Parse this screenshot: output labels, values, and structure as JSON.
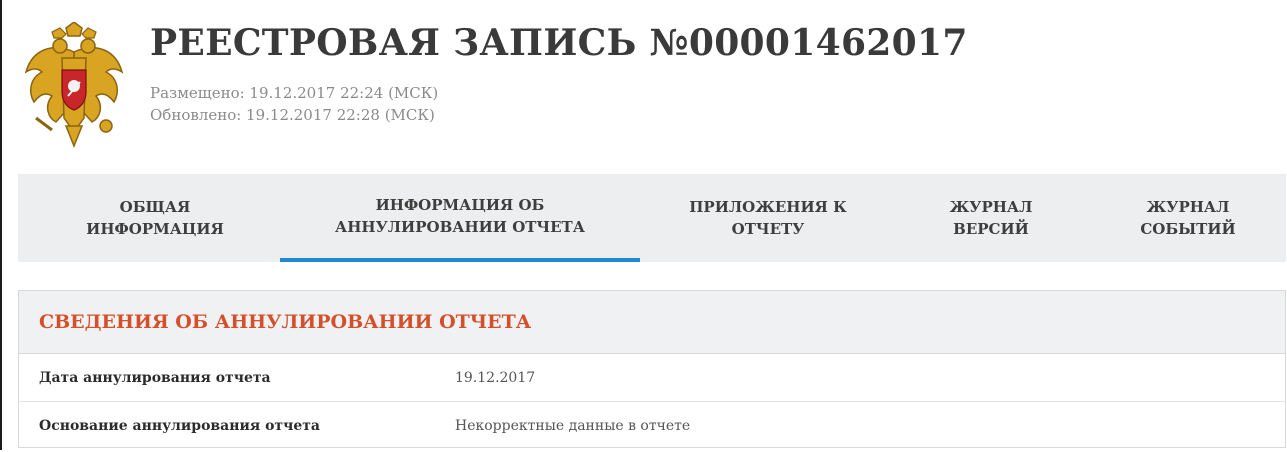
{
  "header": {
    "emblem": "russian-coat-of-arms",
    "title": "РЕЕСТРОВАЯ ЗАПИСЬ №00001462017",
    "posted": "Размещено: 19.12.2017 22:24 (МСК)",
    "updated": "Обновлено: 19.12.2017 22:28 (МСК)"
  },
  "tabs": [
    {
      "line1": "ОБЩАЯ",
      "line2": "ИНФОРМАЦИЯ",
      "active": false
    },
    {
      "line1": "ИНФОРМАЦИЯ ОБ",
      "line2": "АННУЛИРОВАНИИ ОТЧЕТА",
      "active": true
    },
    {
      "line1": "ПРИЛОЖЕНИЯ К",
      "line2": "ОТЧЕТУ",
      "active": false
    },
    {
      "line1": "ЖУРНАЛ",
      "line2": "ВЕРСИЙ",
      "active": false
    },
    {
      "line1": "ЖУРНАЛ",
      "line2": "СОБЫТИЙ",
      "active": false
    }
  ],
  "panel": {
    "title": "СВЕДЕНИЯ ОБ АННУЛИРОВАНИИ ОТЧЕТА",
    "rows": [
      {
        "label": "Дата аннулирования отчета",
        "value": "19.12.2017"
      },
      {
        "label": "Основание аннулирования отчета",
        "value": "Некорректные данные в отчете"
      }
    ]
  },
  "colors": {
    "accent": "#1f8ad2",
    "section_title": "#d4502a",
    "tab_bg": "#eceeef"
  }
}
